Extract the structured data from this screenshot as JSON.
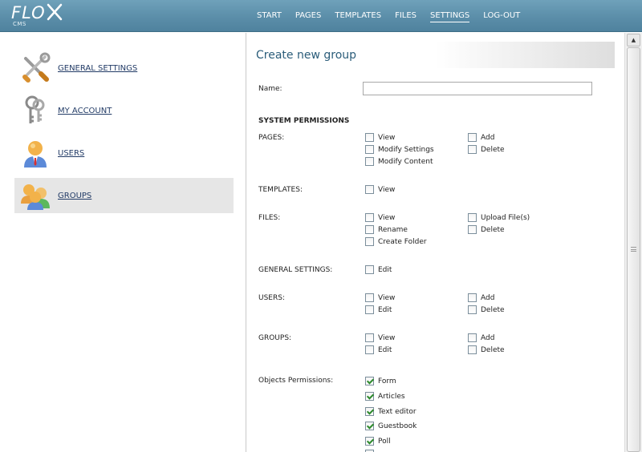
{
  "app": {
    "logo_text": "FLO",
    "logo_sub": "CMS"
  },
  "nav": {
    "items": [
      {
        "label": "START"
      },
      {
        "label": "PAGES"
      },
      {
        "label": "TEMPLATES"
      },
      {
        "label": "FILES"
      },
      {
        "label": "SETTINGS",
        "active": true
      },
      {
        "label": "LOG-OUT"
      }
    ]
  },
  "sidebar": {
    "items": [
      {
        "label": "GENERAL SETTINGS",
        "icon": "tools-icon"
      },
      {
        "label": "MY ACCOUNT",
        "icon": "keys-icon"
      },
      {
        "label": "USERS",
        "icon": "user-icon"
      },
      {
        "label": "GROUPS",
        "icon": "group-icon",
        "active": true
      }
    ]
  },
  "form": {
    "title": "Create new group",
    "name_label": "Name:",
    "name_value": "",
    "system_permissions_heading": "SYSTEM PERMISSIONS",
    "sections": {
      "pages": {
        "label": "PAGES:",
        "view": "View",
        "modify_settings": "Modify Settings",
        "modify_content": "Modify Content",
        "add": "Add",
        "delete": "Delete"
      },
      "templates": {
        "label": "TEMPLATES:",
        "view": "View"
      },
      "files": {
        "label": "FILES:",
        "view": "View",
        "rename": "Rename",
        "create_folder": "Create Folder",
        "upload": "Upload File(s)",
        "delete": "Delete"
      },
      "general": {
        "label": "GENERAL SETTINGS:",
        "edit": "Edit"
      },
      "users": {
        "label": "USERS:",
        "view": "View",
        "edit": "Edit",
        "add": "Add",
        "delete": "Delete"
      },
      "groups": {
        "label": "GROUPS:",
        "view": "View",
        "edit": "Edit",
        "add": "Add",
        "delete": "Delete"
      }
    },
    "objects_label": "Objects Permissions:",
    "objects": [
      {
        "label": "Form",
        "checked": true
      },
      {
        "label": "Articles",
        "checked": true
      },
      {
        "label": "Text editor",
        "checked": true
      },
      {
        "label": "Guestbook",
        "checked": true
      },
      {
        "label": "Poll",
        "checked": true
      }
    ]
  },
  "colors": {
    "header": "#5b8ea9",
    "title": "#2b5d7a",
    "link": "#223b66",
    "check": "#2d8a2d"
  }
}
